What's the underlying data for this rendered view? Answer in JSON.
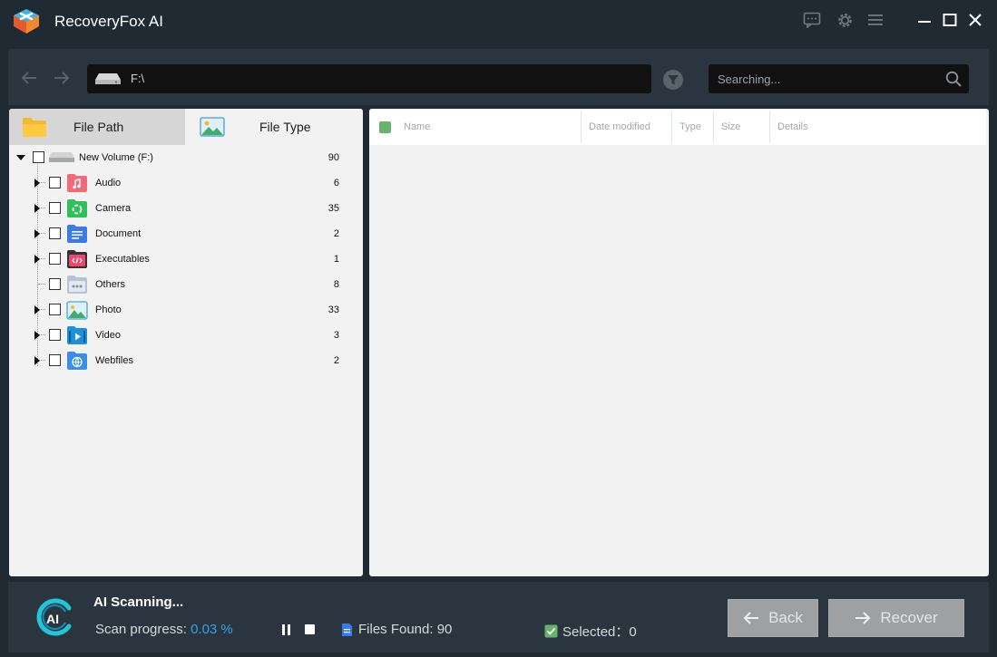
{
  "app": {
    "title": "RecoveryFox AI"
  },
  "toolbar": {
    "path": "F:\\",
    "search_placeholder": "Searching..."
  },
  "tabs": [
    {
      "label": "File Path",
      "active": false
    },
    {
      "label": "File Type",
      "active": true
    }
  ],
  "tree": {
    "root": {
      "label": "New Volume (F:)",
      "count": "90"
    },
    "items": [
      {
        "label": "Audio",
        "count": "6",
        "icon": "audio-folder-icon",
        "color": "#f06a7a",
        "expandable": true
      },
      {
        "label": "Camera",
        "count": "35",
        "icon": "camera-folder-icon",
        "color": "#2fbf5b",
        "expandable": true
      },
      {
        "label": "Document",
        "count": "2",
        "icon": "document-folder-icon",
        "color": "#3b7be6",
        "expandable": true
      },
      {
        "label": "Executables",
        "count": "1",
        "icon": "executables-folder-icon",
        "color": "#e84a6b",
        "expandable": true
      },
      {
        "label": "Others",
        "count": "8",
        "icon": "others-folder-icon",
        "color": "#9aa9c2",
        "expandable": false
      },
      {
        "label": "Photo",
        "count": "33",
        "icon": "photo-folder-icon",
        "color": "#4aa3e0",
        "expandable": true
      },
      {
        "label": "Video",
        "count": "3",
        "icon": "video-folder-icon",
        "color": "#1f8fd6",
        "expandable": true
      },
      {
        "label": "Webfiles",
        "count": "2",
        "icon": "webfiles-folder-icon",
        "color": "#3a8ee8",
        "expandable": true
      }
    ]
  },
  "list": {
    "columns": [
      "Name",
      "Date modified",
      "Type",
      "Size",
      "Details"
    ]
  },
  "status": {
    "title": "AI Scanning...",
    "progress_label": "Scan progress:",
    "progress_value": "0.03 %",
    "files_found": "Files Found: 90",
    "selected": "Selected：0"
  },
  "buttons": {
    "back": "Back",
    "recover": "Recover"
  },
  "colors": {
    "accent": "#31a3ea",
    "check_green": "#67b36c",
    "background": "#1f2a33",
    "panel": "#2a353f"
  }
}
